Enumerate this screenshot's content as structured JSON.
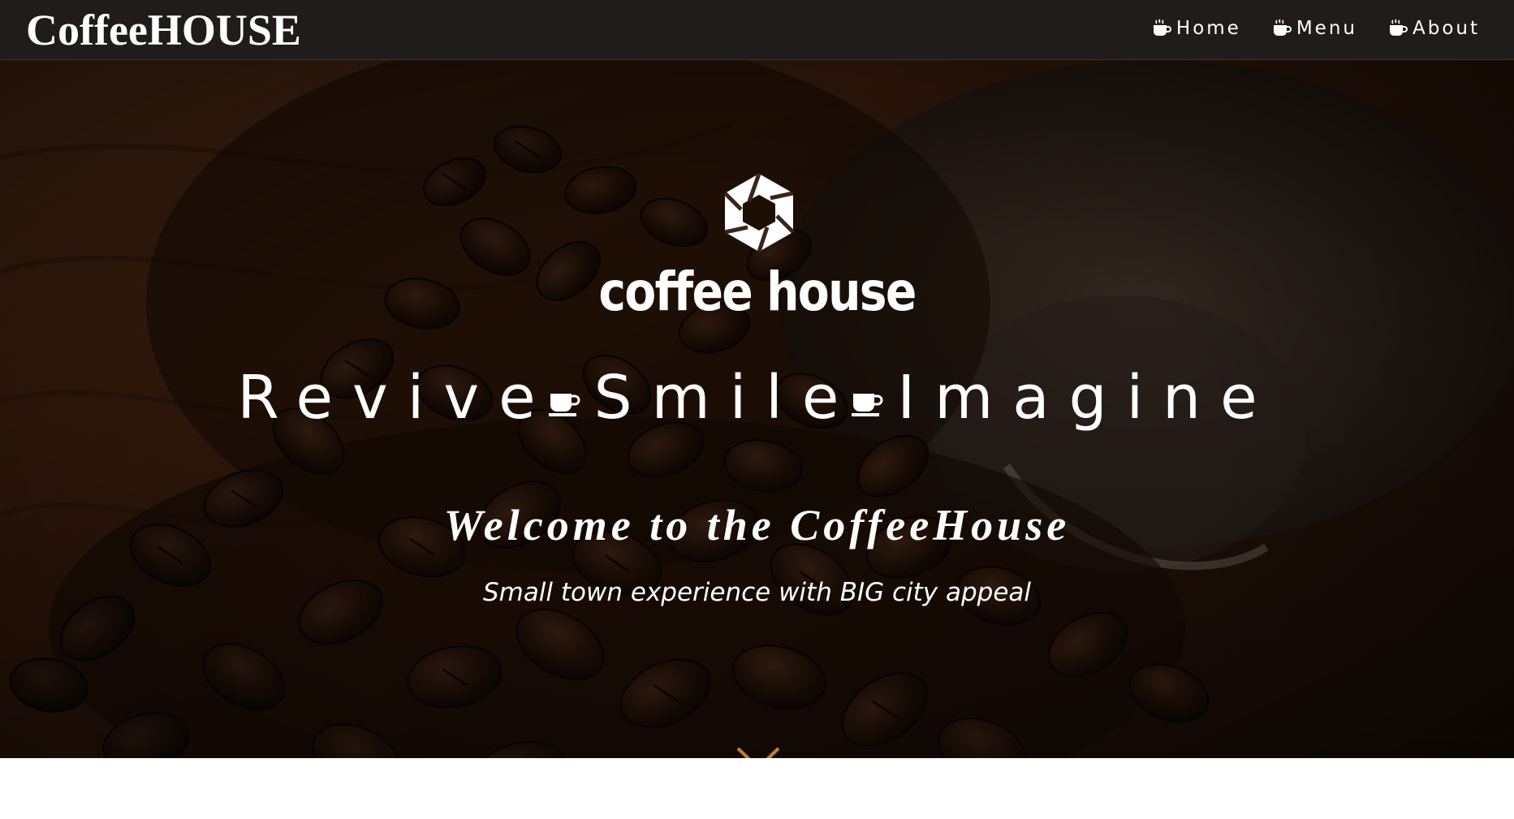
{
  "navbar": {
    "brand": "CoffeeHOUSE",
    "items": [
      {
        "label": "Home",
        "icon": "coffee-cup-icon"
      },
      {
        "label": "Menu",
        "icon": "coffee-cup-icon"
      },
      {
        "label": "About",
        "icon": "coffee-cup-icon"
      }
    ]
  },
  "hero": {
    "logo_icon": "hexagon-shutter-logo-icon",
    "logo_text": "coffee house",
    "tagline": [
      "Revive",
      "Smile",
      "Imagine"
    ],
    "tagline_separator_icon": "coffee-cup-icon",
    "welcome": "Welcome to the CoffeeHouse",
    "subtitle": "Small town experience with BIG city appeal",
    "scroll_icon": "double-chevron-down-icon",
    "background": "coffee beans spilling from a jar onto a wooden table"
  },
  "colors": {
    "navbar_bg": "#201c1c",
    "text": "#ffffff",
    "accent": "#c1812f"
  }
}
